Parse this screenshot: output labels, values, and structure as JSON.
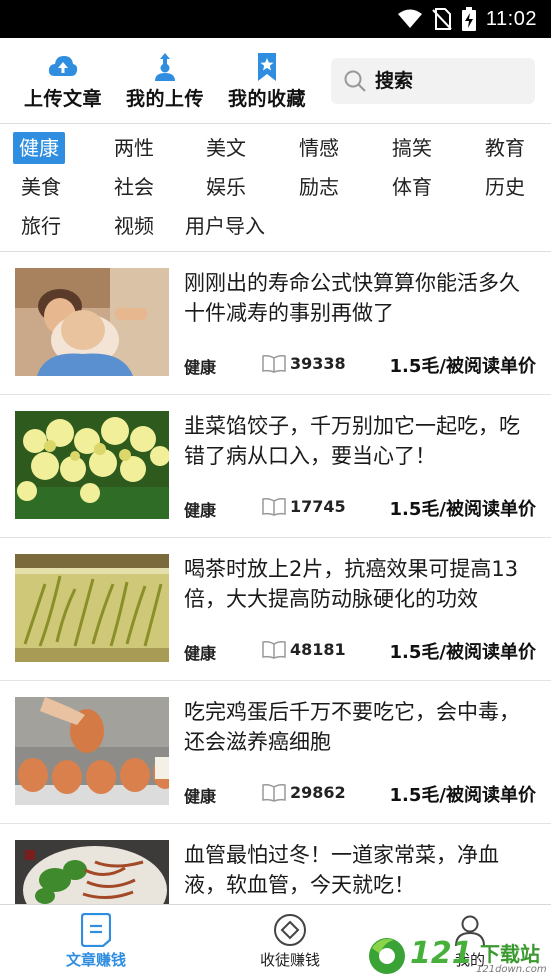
{
  "status_bar": {
    "time": "11:02"
  },
  "header": {
    "actions": [
      {
        "label": "上传文章",
        "icon": "cloud-upload-icon"
      },
      {
        "label": "我的上传",
        "icon": "user-upload-icon"
      },
      {
        "label": "我的收藏",
        "icon": "bookmark-star-icon"
      }
    ],
    "search_placeholder": "搜索"
  },
  "categories": [
    "健康",
    "两性",
    "美文",
    "情感",
    "搞笑",
    "教育",
    "美食",
    "社会",
    "娱乐",
    "励志",
    "体育",
    "历史",
    "旅行",
    "视频",
    "用户导入"
  ],
  "active_category": "健康",
  "articles": [
    {
      "title": "刚刚出的寿命公式快算算你能活多久十件减寿的事别再做了",
      "tag": "健康",
      "reads": "39338",
      "price": "1.5毛/被阅读单价",
      "thumb": "elderly-woman-photo"
    },
    {
      "title": "韭菜馅饺子，千万别加它一起吃，吃错了病从口入，要当心了！",
      "tag": "健康",
      "reads": "17745",
      "price": "1.5毛/被阅读单价",
      "thumb": "chive-flowers-photo"
    },
    {
      "title": "喝茶时放上2片，抗癌效果可提高13倍，大大提高防动脉硬化的功效",
      "tag": "健康",
      "reads": "48181",
      "price": "1.5毛/被阅读单价",
      "thumb": "green-tea-glass-photo"
    },
    {
      "title": "吃完鸡蛋后千万不要吃它，会中毒，还会滋养癌细胞",
      "tag": "健康",
      "reads": "29862",
      "price": "1.5毛/被阅读单价",
      "thumb": "eggs-tray-photo"
    },
    {
      "title": "血管最怕过冬！一道家常菜，净血液，软血管，今天就吃！",
      "tag": "",
      "reads": "",
      "price": "",
      "thumb": "vegetable-dish-photo"
    }
  ],
  "bottom_nav": [
    {
      "label": "文章赚钱",
      "icon": "document-icon",
      "active": true
    },
    {
      "label": "收徒赚钱",
      "icon": "diamond-circle-icon",
      "active": false
    },
    {
      "label": "我的",
      "icon": "person-icon",
      "active": false
    }
  ],
  "watermark": {
    "brand": "121",
    "cn": "下载站",
    "url": "121down.com"
  },
  "colors": {
    "accent": "#2f8ee0",
    "status_bar": "#000000"
  }
}
